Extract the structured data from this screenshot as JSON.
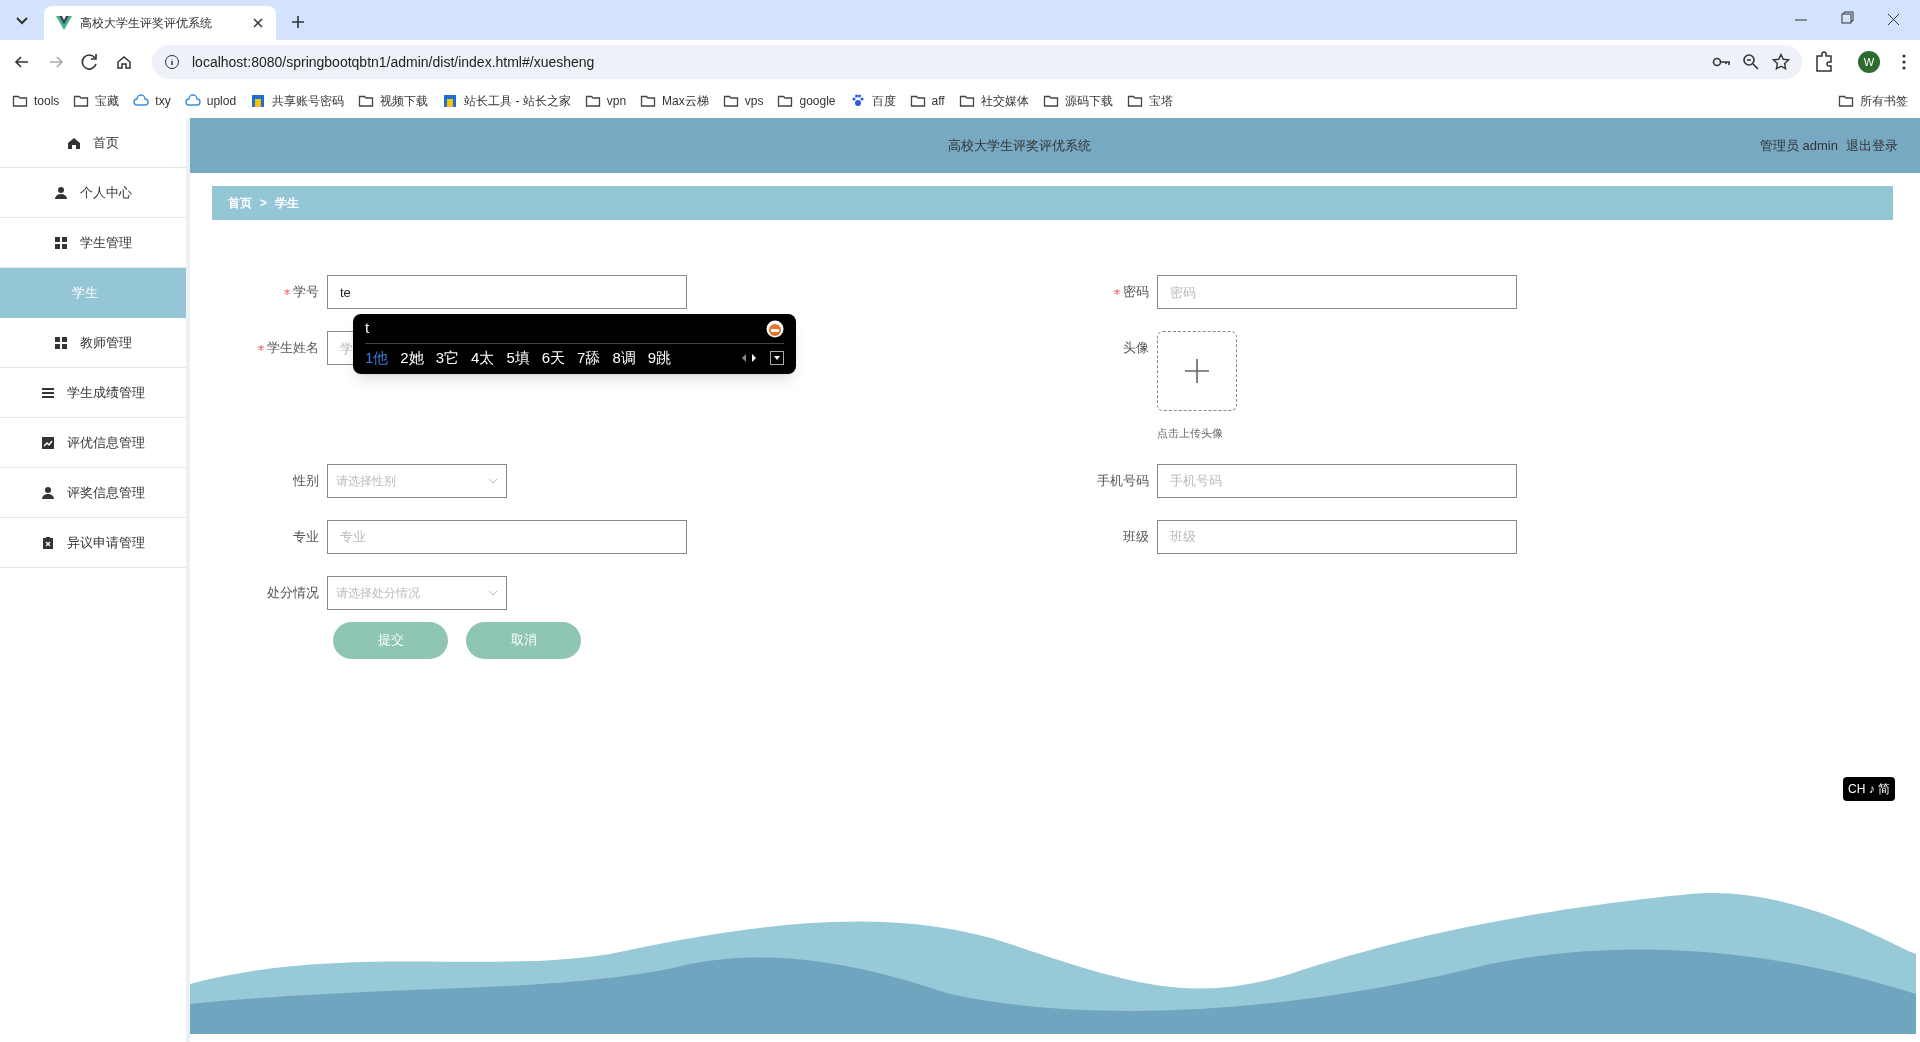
{
  "browser": {
    "tab_title": "高校大学生评奖评优系统",
    "url": "localhost:8080/springbootqbtn1/admin/dist/index.html#/xuesheng",
    "profile": "W",
    "bookmarks": [
      {
        "label": "tools",
        "kind": "folder"
      },
      {
        "label": "宝藏",
        "kind": "folder"
      },
      {
        "label": "txy",
        "kind": "cloud"
      },
      {
        "label": "uplod",
        "kind": "cloud"
      },
      {
        "label": "共享账号密码",
        "kind": "site"
      },
      {
        "label": "视频下载",
        "kind": "folder"
      },
      {
        "label": "站长工具 - 站长之家",
        "kind": "site"
      },
      {
        "label": "vpn",
        "kind": "folder"
      },
      {
        "label": "Max云梯",
        "kind": "folder"
      },
      {
        "label": "vps",
        "kind": "folder"
      },
      {
        "label": "google",
        "kind": "folder"
      },
      {
        "label": "百度",
        "kind": "paw"
      },
      {
        "label": "aff",
        "kind": "folder"
      },
      {
        "label": "社交媒体",
        "kind": "folder"
      },
      {
        "label": "源码下载",
        "kind": "folder"
      },
      {
        "label": "宝塔",
        "kind": "folder"
      }
    ],
    "all_bookmarks": "所有书签"
  },
  "sidebar": {
    "items": [
      {
        "label": "首页",
        "kind": "home",
        "selected": false
      },
      {
        "label": "个人中心",
        "kind": "user",
        "selected": false
      },
      {
        "label": "学生管理",
        "kind": "grid",
        "selected": false
      },
      {
        "label": "学生",
        "kind": "sub",
        "selected": true
      },
      {
        "label": "教师管理",
        "kind": "grid",
        "selected": false
      },
      {
        "label": "学生成绩管理",
        "kind": "list",
        "selected": false
      },
      {
        "label": "评优信息管理",
        "kind": "chart",
        "selected": false
      },
      {
        "label": "评奖信息管理",
        "kind": "user",
        "selected": false
      },
      {
        "label": "异议申请管理",
        "kind": "clipboard",
        "selected": false
      }
    ]
  },
  "header": {
    "title": "高校大学生评奖评优系统",
    "user": "管理员 admin",
    "logout": "退出登录"
  },
  "breadcrumb": {
    "items": [
      "首页",
      "学生"
    ],
    "separator": ">"
  },
  "form": {
    "rows": [
      {
        "fields": [
          {
            "label": "学号",
            "required": true,
            "kind": "input",
            "value": "te"
          },
          {
            "label": "密码",
            "required": true,
            "kind": "input",
            "placeholder": "密码"
          }
        ]
      },
      {
        "fields": [
          {
            "label": "学生姓名",
            "required": true,
            "kind": "input",
            "placeholder": "学"
          },
          {
            "label": "头像",
            "required": false,
            "kind": "upload",
            "hint": "点击上传头像"
          }
        ]
      },
      {
        "fields": [
          {
            "label": "性别",
            "required": false,
            "kind": "select",
            "placeholder": "请选择性别"
          },
          {
            "label": "手机号码",
            "required": false,
            "kind": "input",
            "placeholder": "手机号码"
          }
        ]
      },
      {
        "fields": [
          {
            "label": "专业",
            "required": false,
            "kind": "input",
            "placeholder": "专业"
          },
          {
            "label": "班级",
            "required": false,
            "kind": "input",
            "placeholder": "班级"
          }
        ]
      },
      {
        "fields": [
          {
            "label": "处分情况",
            "required": false,
            "kind": "select",
            "placeholder": "请选择处分情况"
          }
        ]
      }
    ],
    "buttons": [
      "提交",
      "取消"
    ]
  },
  "ime": {
    "composition": "t",
    "candidates": [
      {
        "text": "1他",
        "selected": true
      },
      {
        "text": "2她",
        "selected": false
      },
      {
        "text": "3它",
        "selected": false
      },
      {
        "text": "4太",
        "selected": false
      },
      {
        "text": "5填",
        "selected": false
      },
      {
        "text": "6天",
        "selected": false
      },
      {
        "text": "7舔",
        "selected": false
      },
      {
        "text": "8调",
        "selected": false
      },
      {
        "text": "9跳",
        "selected": false
      }
    ]
  },
  "language_indicator": "CH ♪ 简"
}
